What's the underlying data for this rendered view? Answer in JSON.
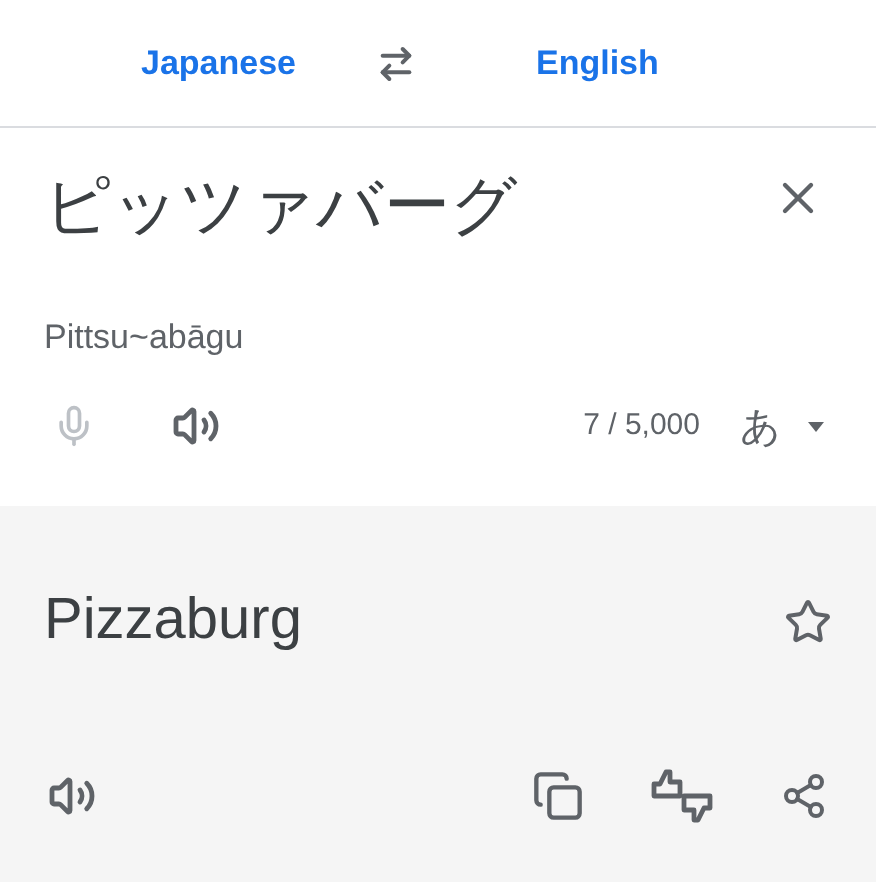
{
  "languages": {
    "source": "Japanese",
    "target": "English"
  },
  "input": {
    "text": "ピッツァバーグ",
    "romanization": "Pittsu~abāgu",
    "mic_disabled": true,
    "char_count": "7 / 5,000",
    "keyboard": "あ"
  },
  "output": {
    "text": "Pizzaburg",
    "starred": false
  }
}
